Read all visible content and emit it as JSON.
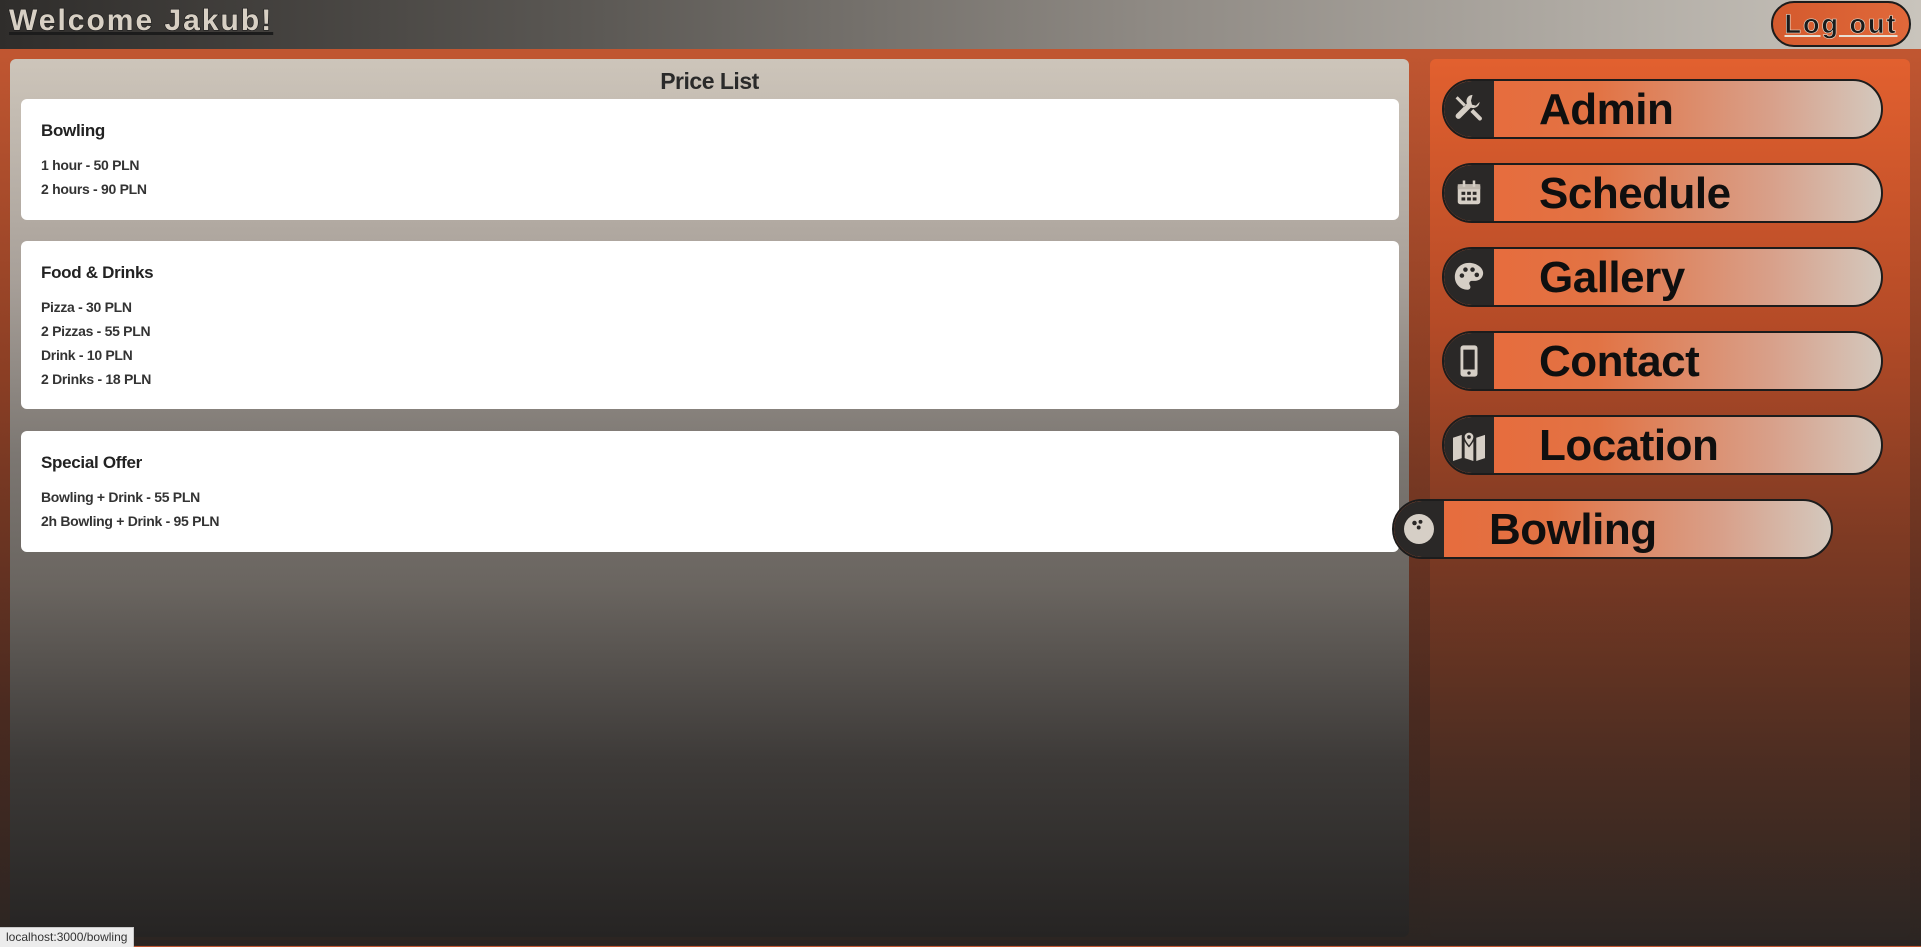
{
  "header": {
    "welcome": "Welcome Jakub!",
    "logout_label": "Log out"
  },
  "price_list": {
    "title": "Price List",
    "sections": [
      {
        "title": "Bowling",
        "items": [
          "1 hour - 50 PLN",
          "2 hours - 90 PLN"
        ]
      },
      {
        "title": "Food & Drinks",
        "items": [
          "Pizza - 30 PLN",
          "2 Pizzas - 55 PLN",
          "Drink - 10 PLN",
          "2 Drinks - 18 PLN"
        ]
      },
      {
        "title": "Special Offer",
        "items": [
          "Bowling + Drink - 55 PLN",
          "2h Bowling + Drink - 95 PLN"
        ]
      }
    ]
  },
  "nav": {
    "items": [
      {
        "label": "Admin",
        "icon": "tools-icon"
      },
      {
        "label": "Schedule",
        "icon": "calendar-icon"
      },
      {
        "label": "Gallery",
        "icon": "palette-icon"
      },
      {
        "label": "Contact",
        "icon": "phone-icon"
      },
      {
        "label": "Location",
        "icon": "map-icon"
      },
      {
        "label": "Bowling",
        "icon": "bowling-ball-icon",
        "active": true
      }
    ]
  },
  "status_bar": {
    "url": "localhost:3000/bowling"
  },
  "colors": {
    "accent": "#e2602f",
    "dark": "#2a2827",
    "card": "#ffffff"
  }
}
